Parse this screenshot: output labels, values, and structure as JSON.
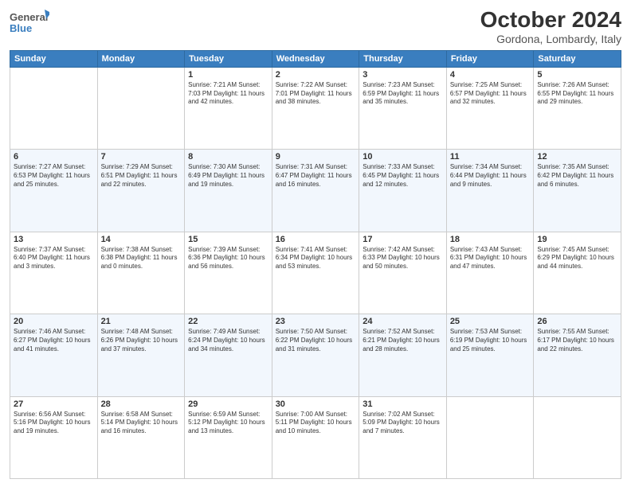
{
  "header": {
    "title": "October 2024",
    "subtitle": "Gordona, Lombardy, Italy",
    "logo_line1": "General",
    "logo_line2": "Blue"
  },
  "weekdays": [
    "Sunday",
    "Monday",
    "Tuesday",
    "Wednesday",
    "Thursday",
    "Friday",
    "Saturday"
  ],
  "weeks": [
    [
      {
        "day": "",
        "info": ""
      },
      {
        "day": "",
        "info": ""
      },
      {
        "day": "1",
        "info": "Sunrise: 7:21 AM\nSunset: 7:03 PM\nDaylight: 11 hours and 42 minutes."
      },
      {
        "day": "2",
        "info": "Sunrise: 7:22 AM\nSunset: 7:01 PM\nDaylight: 11 hours and 38 minutes."
      },
      {
        "day": "3",
        "info": "Sunrise: 7:23 AM\nSunset: 6:59 PM\nDaylight: 11 hours and 35 minutes."
      },
      {
        "day": "4",
        "info": "Sunrise: 7:25 AM\nSunset: 6:57 PM\nDaylight: 11 hours and 32 minutes."
      },
      {
        "day": "5",
        "info": "Sunrise: 7:26 AM\nSunset: 6:55 PM\nDaylight: 11 hours and 29 minutes."
      }
    ],
    [
      {
        "day": "6",
        "info": "Sunrise: 7:27 AM\nSunset: 6:53 PM\nDaylight: 11 hours and 25 minutes."
      },
      {
        "day": "7",
        "info": "Sunrise: 7:29 AM\nSunset: 6:51 PM\nDaylight: 11 hours and 22 minutes."
      },
      {
        "day": "8",
        "info": "Sunrise: 7:30 AM\nSunset: 6:49 PM\nDaylight: 11 hours and 19 minutes."
      },
      {
        "day": "9",
        "info": "Sunrise: 7:31 AM\nSunset: 6:47 PM\nDaylight: 11 hours and 16 minutes."
      },
      {
        "day": "10",
        "info": "Sunrise: 7:33 AM\nSunset: 6:45 PM\nDaylight: 11 hours and 12 minutes."
      },
      {
        "day": "11",
        "info": "Sunrise: 7:34 AM\nSunset: 6:44 PM\nDaylight: 11 hours and 9 minutes."
      },
      {
        "day": "12",
        "info": "Sunrise: 7:35 AM\nSunset: 6:42 PM\nDaylight: 11 hours and 6 minutes."
      }
    ],
    [
      {
        "day": "13",
        "info": "Sunrise: 7:37 AM\nSunset: 6:40 PM\nDaylight: 11 hours and 3 minutes."
      },
      {
        "day": "14",
        "info": "Sunrise: 7:38 AM\nSunset: 6:38 PM\nDaylight: 11 hours and 0 minutes."
      },
      {
        "day": "15",
        "info": "Sunrise: 7:39 AM\nSunset: 6:36 PM\nDaylight: 10 hours and 56 minutes."
      },
      {
        "day": "16",
        "info": "Sunrise: 7:41 AM\nSunset: 6:34 PM\nDaylight: 10 hours and 53 minutes."
      },
      {
        "day": "17",
        "info": "Sunrise: 7:42 AM\nSunset: 6:33 PM\nDaylight: 10 hours and 50 minutes."
      },
      {
        "day": "18",
        "info": "Sunrise: 7:43 AM\nSunset: 6:31 PM\nDaylight: 10 hours and 47 minutes."
      },
      {
        "day": "19",
        "info": "Sunrise: 7:45 AM\nSunset: 6:29 PM\nDaylight: 10 hours and 44 minutes."
      }
    ],
    [
      {
        "day": "20",
        "info": "Sunrise: 7:46 AM\nSunset: 6:27 PM\nDaylight: 10 hours and 41 minutes."
      },
      {
        "day": "21",
        "info": "Sunrise: 7:48 AM\nSunset: 6:26 PM\nDaylight: 10 hours and 37 minutes."
      },
      {
        "day": "22",
        "info": "Sunrise: 7:49 AM\nSunset: 6:24 PM\nDaylight: 10 hours and 34 minutes."
      },
      {
        "day": "23",
        "info": "Sunrise: 7:50 AM\nSunset: 6:22 PM\nDaylight: 10 hours and 31 minutes."
      },
      {
        "day": "24",
        "info": "Sunrise: 7:52 AM\nSunset: 6:21 PM\nDaylight: 10 hours and 28 minutes."
      },
      {
        "day": "25",
        "info": "Sunrise: 7:53 AM\nSunset: 6:19 PM\nDaylight: 10 hours and 25 minutes."
      },
      {
        "day": "26",
        "info": "Sunrise: 7:55 AM\nSunset: 6:17 PM\nDaylight: 10 hours and 22 minutes."
      }
    ],
    [
      {
        "day": "27",
        "info": "Sunrise: 6:56 AM\nSunset: 5:16 PM\nDaylight: 10 hours and 19 minutes."
      },
      {
        "day": "28",
        "info": "Sunrise: 6:58 AM\nSunset: 5:14 PM\nDaylight: 10 hours and 16 minutes."
      },
      {
        "day": "29",
        "info": "Sunrise: 6:59 AM\nSunset: 5:12 PM\nDaylight: 10 hours and 13 minutes."
      },
      {
        "day": "30",
        "info": "Sunrise: 7:00 AM\nSunset: 5:11 PM\nDaylight: 10 hours and 10 minutes."
      },
      {
        "day": "31",
        "info": "Sunrise: 7:02 AM\nSunset: 5:09 PM\nDaylight: 10 hours and 7 minutes."
      },
      {
        "day": "",
        "info": ""
      },
      {
        "day": "",
        "info": ""
      }
    ]
  ]
}
